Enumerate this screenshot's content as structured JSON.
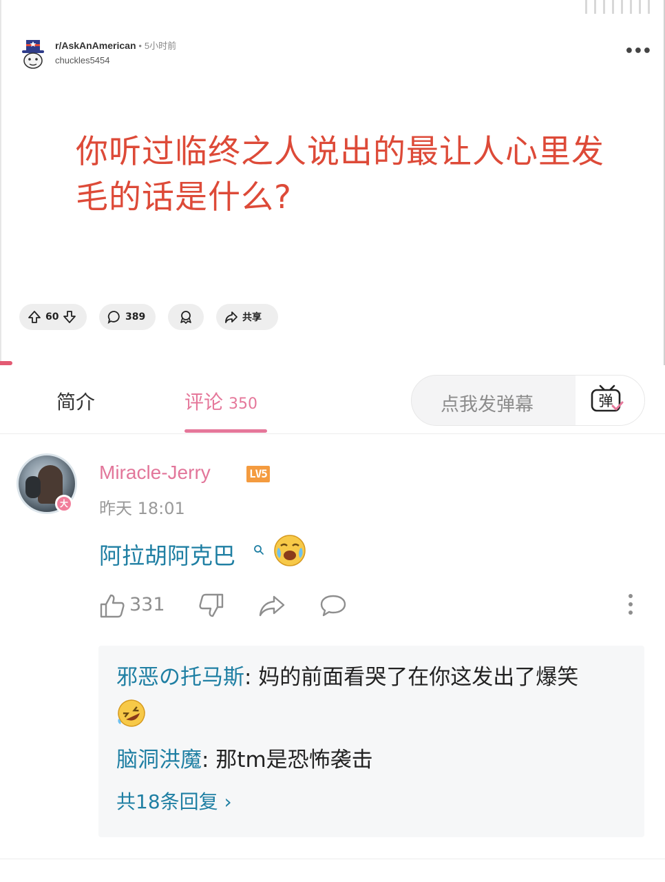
{
  "post": {
    "subreddit": "r/AskAnAmerican",
    "separator": "•",
    "time": "5小时前",
    "user": "chuckles5454",
    "title": "你听过临终之人说出的最让人心里发毛的话是什么?",
    "votes": "60",
    "comments": "389",
    "share_label": "共享"
  },
  "tabs": {
    "intro": "简介",
    "comments_label": "评论",
    "comments_count": "350",
    "danmaku_placeholder": "点我发弹幕",
    "danmaku_button": "弹"
  },
  "comment": {
    "username": "Miracle-Jerry",
    "level": "LV5",
    "badge": "大",
    "time": "昨天 18:01",
    "text": "阿拉胡阿克巴",
    "likes": "331",
    "replies": [
      {
        "user": "邪恶の托马斯",
        "text": ": 妈的前面看哭了在你这发出了爆笑"
      },
      {
        "user": "脑洞洪魔",
        "text": ": 那tm是恐怖袭击"
      }
    ],
    "more_replies": "共18条回复 ›"
  },
  "colors": {
    "title_red": "#dd4a38",
    "bili_pink": "#e5779a",
    "link_blue": "#1f7fa3",
    "level_orange": "#f49b3f"
  }
}
